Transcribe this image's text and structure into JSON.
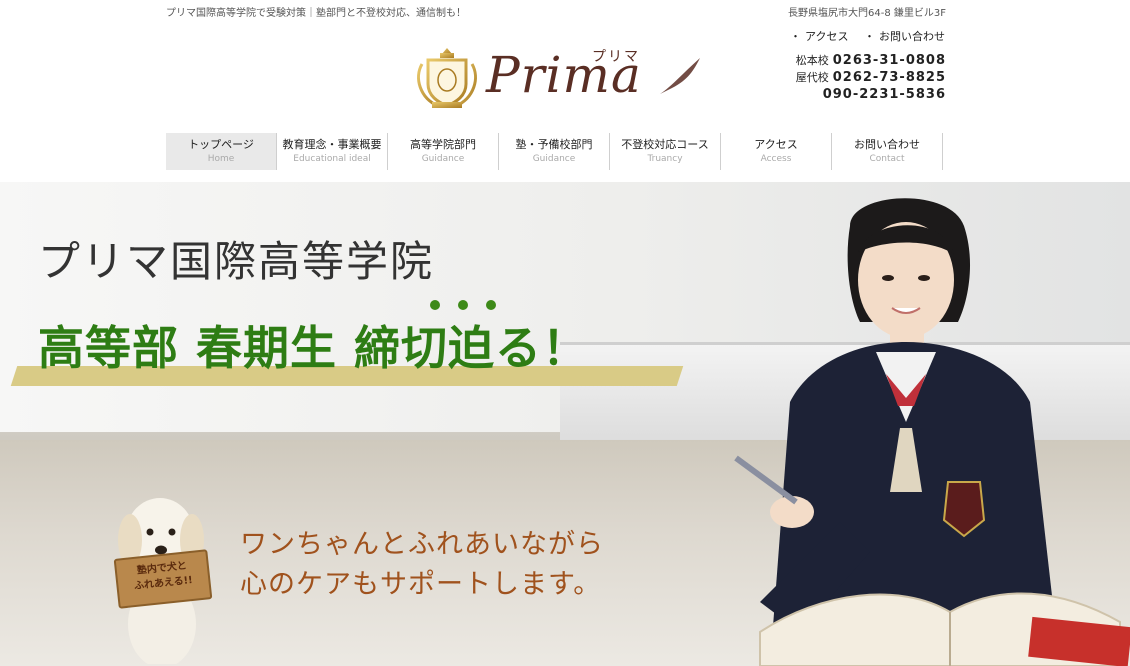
{
  "header": {
    "tagline": "プリマ国際高等学院で受験対策｜塾部門と不登校対応、通信制も！",
    "address": "長野県塩尻市大門64-8 鎌里ビル3F",
    "logo": {
      "script": "Prima",
      "furigana": "プリマ"
    },
    "toplinks": [
      {
        "label": "アクセス"
      },
      {
        "label": "お問い合わせ"
      }
    ],
    "phones": [
      {
        "label": "松本校",
        "number": "0263-31-0808"
      },
      {
        "label": "屋代校",
        "number": "0262-73-8825"
      },
      {
        "label": "",
        "number": "090-2231-5836"
      }
    ]
  },
  "nav": [
    {
      "jp": "トップページ",
      "en": "Home",
      "active": true
    },
    {
      "jp": "教育理念・事業概要",
      "en": "Educational ideal"
    },
    {
      "jp": "高等学院部門",
      "en": "Guidance"
    },
    {
      "jp": "塾・予備校部門",
      "en": "Guidance"
    },
    {
      "jp": "不登校対応コース",
      "en": "Truancy"
    },
    {
      "jp": "アクセス",
      "en": "Access"
    },
    {
      "jp": "お問い合わせ",
      "en": "Contact"
    }
  ],
  "hero": {
    "school_name": "プリマ国際高等学院",
    "headline": "高等部 春期生 締切迫る！",
    "catch_line1": "ワンちゃんとふれあいながら",
    "catch_line2": "心のケアもサポートします。",
    "dog_sign_line1": "塾内で犬と",
    "dog_sign_line2": "ふれあえる!!"
  },
  "colors": {
    "headline": "#2e7d14",
    "catch": "#a0521d",
    "logo": "#5a2e24",
    "banner_bar": "#d9cb86",
    "nav_active": "#e9e9e9"
  }
}
